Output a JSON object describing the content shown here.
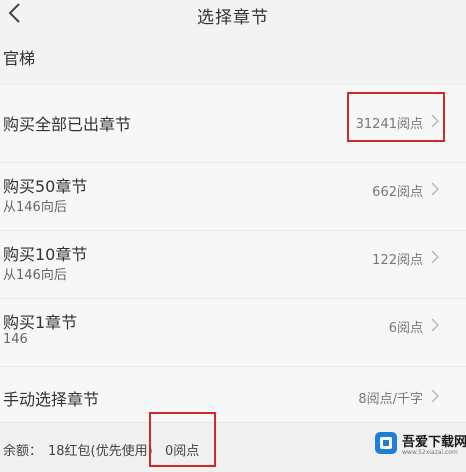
{
  "header": {
    "title": "选择章节",
    "back_icon": "chevron-left-icon"
  },
  "book": {
    "name": "官梯"
  },
  "options": [
    {
      "title": "购买全部已出章节",
      "subtitle": "",
      "price": "31241阅点"
    },
    {
      "title": "购买50章节",
      "subtitle": "从146向后",
      "price": "662阅点"
    },
    {
      "title": "购买10章节",
      "subtitle": "从146向后",
      "price": "122阅点"
    },
    {
      "title": "购买1章节",
      "subtitle": "146",
      "price": "6阅点"
    },
    {
      "title": "手动选择章节",
      "subtitle": "",
      "price": "8阅点/千字"
    }
  ],
  "footer": {
    "balance_label": "余额：",
    "red_packet": "18红包(优先使用)",
    "points": "0阅点"
  },
  "watermark": {
    "text": "吾爱下载网",
    "url": "www.52xiazai.com"
  },
  "colors": {
    "highlight_box": "#d3272c",
    "background": "#f3f3f3"
  }
}
